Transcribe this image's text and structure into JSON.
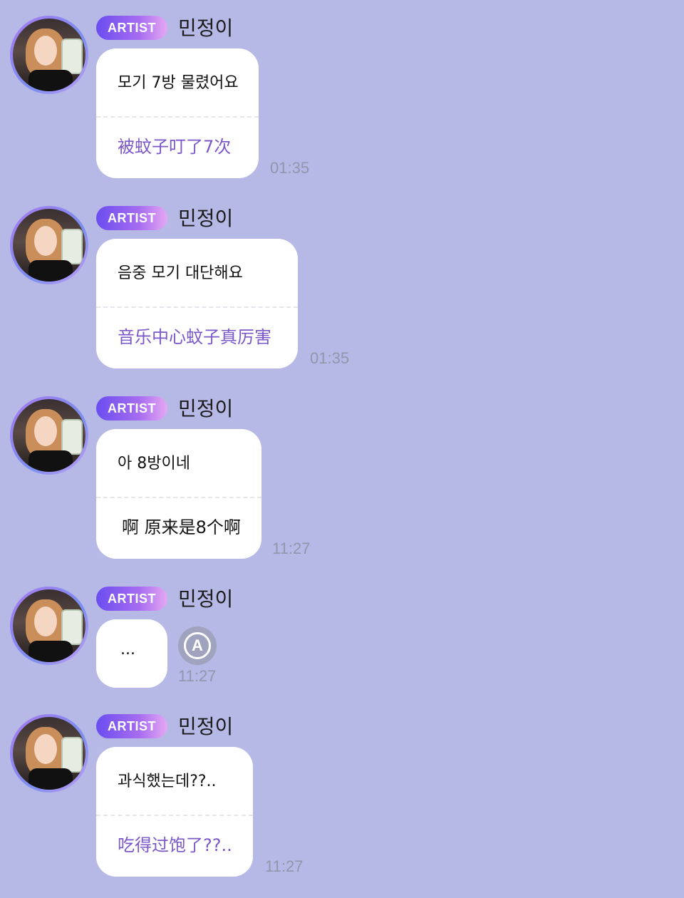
{
  "messages": [
    {
      "badge": "ARTIST",
      "name": "민정이",
      "korean": "모기 7방 물렸어요",
      "chinese": "被蚊子叮了7次",
      "time": "01:35"
    },
    {
      "badge": "ARTIST",
      "name": "민정이",
      "korean": "음중 모기 대단해요",
      "chinese": "音乐中心蚊子真厉害",
      "time": "01:35"
    },
    {
      "badge": "ARTIST",
      "name": "민정이",
      "korean": "아 8방이네",
      "chinese": "啊 原来是8个啊",
      "time": "11:27"
    },
    {
      "badge": "ARTIST",
      "name": "민정이",
      "korean": "...",
      "chinese": "",
      "time": "11:27",
      "icon": "translate-icon"
    },
    {
      "badge": "ARTIST",
      "name": "민정이",
      "korean": "과식했는데??..",
      "chinese": "吃得过饱了??..",
      "time": "11:27"
    }
  ],
  "colors": {
    "background": "#b6b9e6",
    "badge_start": "#6b4df0",
    "badge_end": "#e5a8f3",
    "translation_text": "#7b57c8",
    "time_text": "#9196ad"
  }
}
